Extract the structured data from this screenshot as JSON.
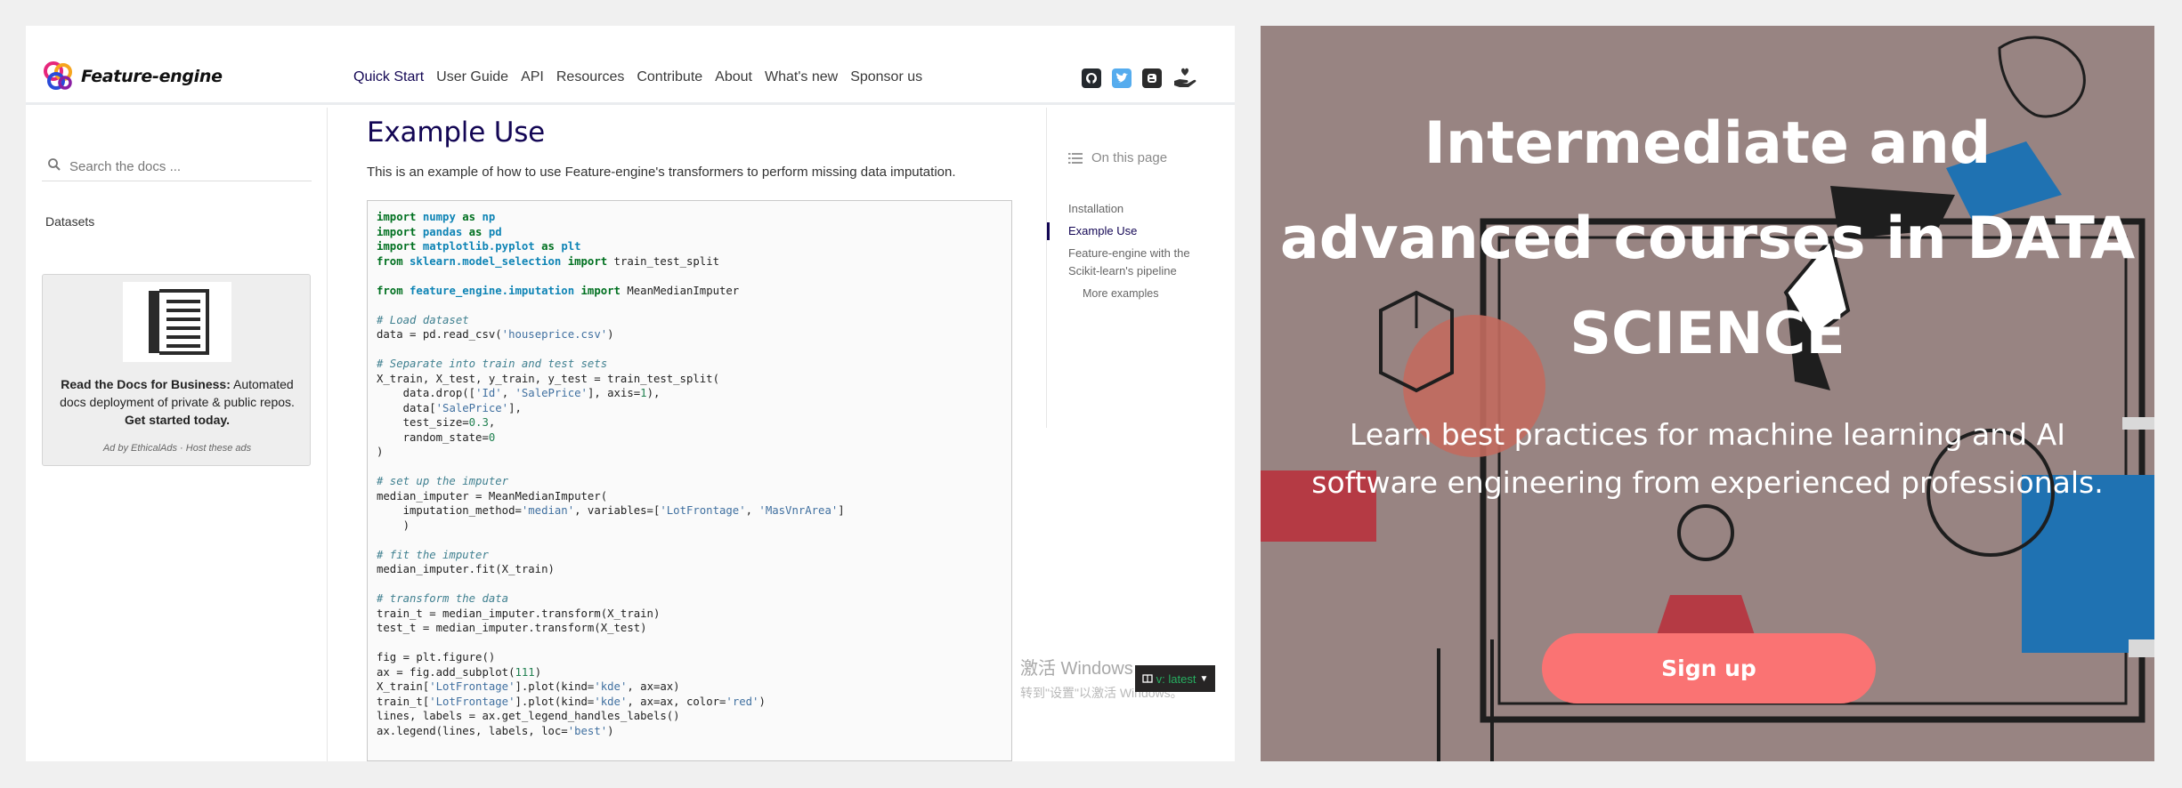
{
  "docs": {
    "brand": "Feature-engine",
    "nav": [
      "Quick Start",
      "User Guide",
      "API",
      "Resources",
      "Contribute",
      "About",
      "What's new",
      "Sponsor us"
    ],
    "nav_active": "Quick Start",
    "social_icons": [
      "github-icon",
      "twitter-icon",
      "blogger-icon",
      "sponsor-icon"
    ],
    "search": {
      "placeholder": "Search the docs ..."
    },
    "sidebar": {
      "items": [
        "Datasets"
      ]
    },
    "ad": {
      "bold_lead": "Read the Docs for Business:",
      "text": "Automated docs deployment of private & public repos.",
      "cta": "Get started today.",
      "footer": "Ad by EthicalAds · Host these ads"
    },
    "page": {
      "title": "Example Use",
      "intro": "This is an example of how to use Feature-engine's transformers to perform missing data imputation."
    },
    "toc": {
      "heading": "On this page",
      "items": [
        {
          "label": "Installation",
          "level": 1,
          "active": false
        },
        {
          "label": "Example Use",
          "level": 1,
          "active": true
        },
        {
          "label": "Feature-engine with the Scikit-learn's pipeline",
          "level": 1,
          "active": false
        },
        {
          "label": "More examples",
          "level": 2,
          "active": false
        }
      ]
    },
    "watermark": {
      "line1": "激活 Windows",
      "line2": "转到\"设置\"以激活 Windows。"
    },
    "version_badge": "v: latest"
  },
  "hero": {
    "title": "Intermediate and advanced courses in DATA SCIENCE",
    "subtitle": "Learn best practices for machine learning and AI software engineering from experienced professionals.",
    "button": "Sign up",
    "colors": {
      "background": "#988482",
      "button": "#fa7373"
    }
  }
}
